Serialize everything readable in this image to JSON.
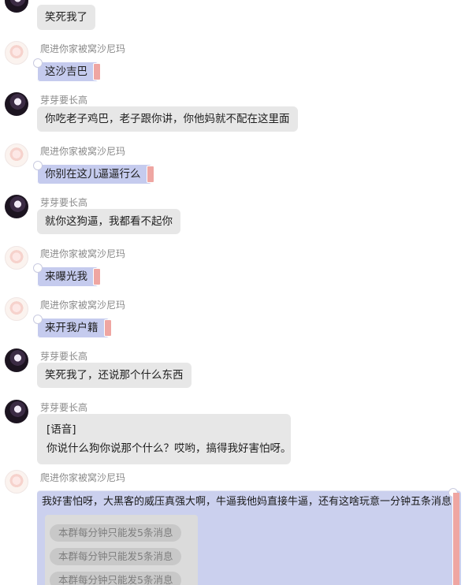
{
  "messages": [
    {
      "sender": "芽芽要长高",
      "text": "笑死我了"
    },
    {
      "sender": "爬进你家被窝沙尼玛",
      "text": "这沙吉巴"
    },
    {
      "sender": "芽芽要长高",
      "text": "你吃老子鸡巴，老子跟你讲，你他妈就不配在这里面"
    },
    {
      "sender": "爬进你家被窝沙尼玛",
      "text": "你别在这儿逼逼行么"
    },
    {
      "sender": "芽芽要长高",
      "text": "就你这狗逼，我都看不起你"
    },
    {
      "sender": "爬进你家被窝沙尼玛",
      "text": "来曝光我"
    },
    {
      "sender": "爬进你家被窝沙尼玛",
      "text": "来开我户籍"
    },
    {
      "sender": "芽芽要长高",
      "text": "笑死我了，还说那个什么东西"
    },
    {
      "sender": "芽芽要长高",
      "line1": "[语音]",
      "line2": "你说什么狗你说那个什么？哎哟，搞得我好害怕呀。"
    },
    {
      "sender": "爬进你家被窝沙尼玛",
      "text": "我好害怕呀，大黑客的威压真强大啊，牛逼我他妈直接牛逼，还有这啥玩意一分钟五条消息"
    }
  ],
  "system_notices": [
    "本群每分钟只能发5条消息",
    "本群每分钟只能发5条消息",
    "本群每分钟只能发5条消息"
  ]
}
